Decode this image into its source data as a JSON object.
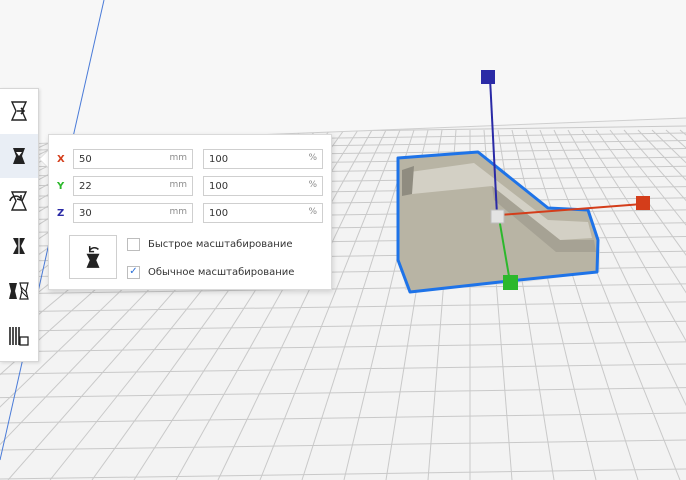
{
  "colors": {
    "accent": "#1e73e8",
    "axis_x": "#d43d1a",
    "axis_y": "#2cb82c",
    "axis_z": "#2a2aa6",
    "model_fill": "#b8b4a4",
    "build_plate": "#f3f3f3"
  },
  "toolbar": {
    "tools": [
      {
        "icon": "move-tool-icon",
        "active": false
      },
      {
        "icon": "scale-tool-icon",
        "active": true
      },
      {
        "icon": "rotate-tool-icon",
        "active": false
      },
      {
        "icon": "mirror-tool-icon",
        "active": false
      },
      {
        "icon": "per-model-settings-icon",
        "active": false
      },
      {
        "icon": "support-blocker-icon",
        "active": false
      }
    ]
  },
  "scale_panel": {
    "x": {
      "label": "X",
      "value": "50",
      "unit": "mm",
      "percent": "100",
      "percent_unit": "%"
    },
    "y": {
      "label": "Y",
      "value": "22",
      "unit": "mm",
      "percent": "100",
      "percent_unit": "%"
    },
    "z": {
      "label": "Z",
      "value": "30",
      "unit": "mm",
      "percent": "100",
      "percent_unit": "%"
    },
    "reset_icon": "reset-scale-icon",
    "snap_scaling": {
      "label": "Быстрое масштабирование",
      "checked": false
    },
    "uniform_scaling": {
      "label": "Обычное масштабирование",
      "checked": true
    }
  }
}
